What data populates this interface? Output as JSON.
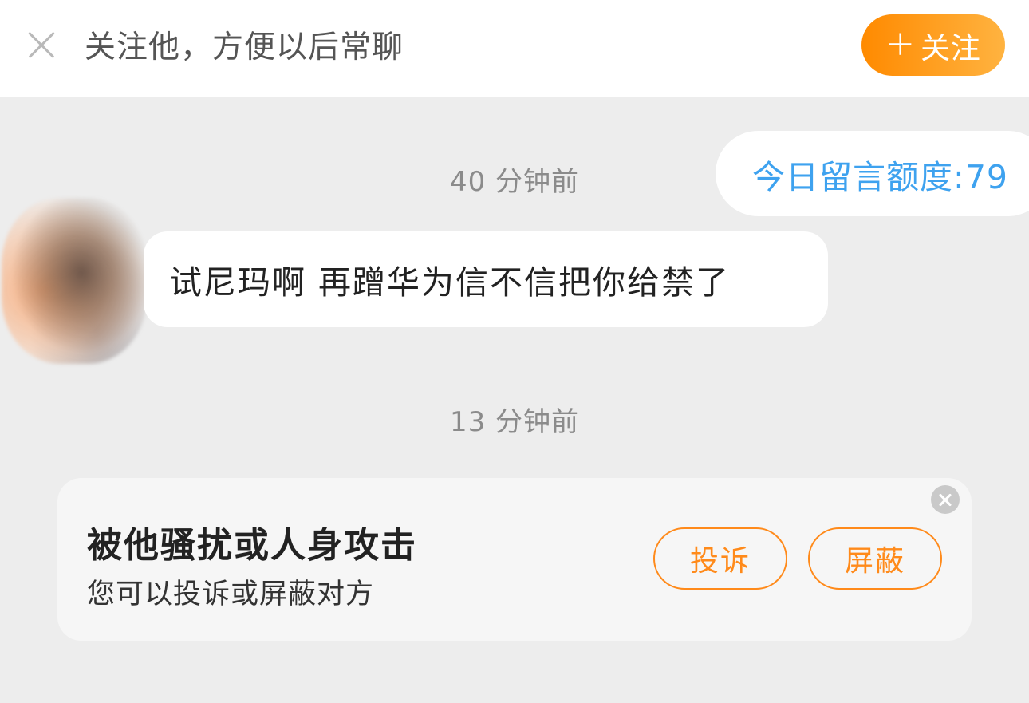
{
  "topbar": {
    "text": "关注他，方便以后常聊",
    "follow_plus": "+",
    "follow_label": "关注"
  },
  "quota": {
    "text": "今日留言额度:79"
  },
  "messages": [
    {
      "timestamp": "40 分钟前",
      "text": "试尼玛啊 再蹭华为信不信把你给禁了"
    },
    {
      "timestamp": "13 分钟前"
    }
  ],
  "harassment_card": {
    "title": "被他骚扰或人身攻击",
    "subtitle": "您可以投诉或屏蔽对方",
    "report_label": "投诉",
    "block_label": "屏蔽"
  },
  "icons": {
    "topbar_close": "close-icon",
    "card_close": "close-circle-icon",
    "follow": "plus-icon"
  },
  "colors": {
    "accent": "#ff8a1a",
    "quota_text": "#3ea2ef",
    "background": "#ededed"
  }
}
